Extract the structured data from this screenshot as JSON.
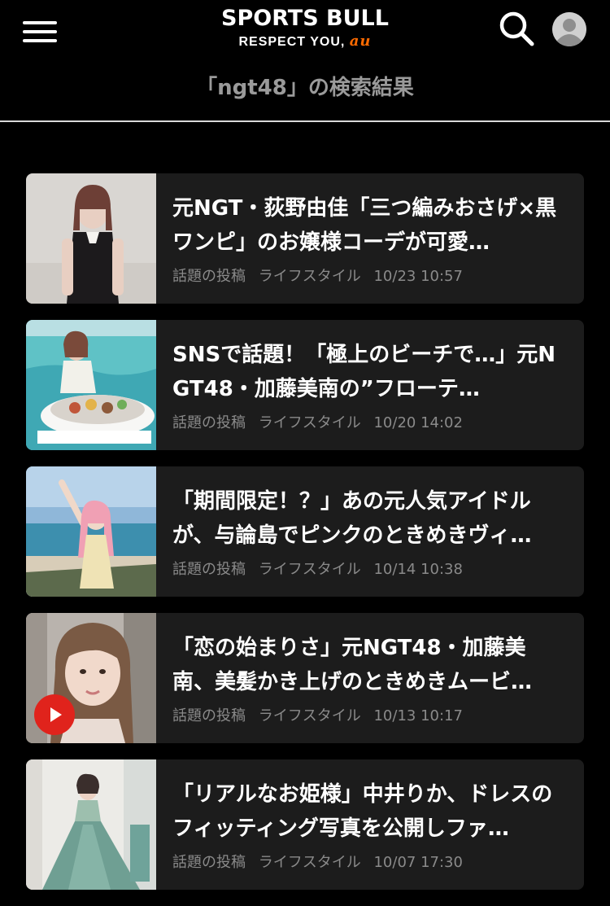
{
  "header": {
    "logo_main": "SPORTS BULL",
    "logo_sub": "RESPECT YOU,",
    "logo_au": "au",
    "search_title": "「ngt48」の検索結果"
  },
  "articles": [
    {
      "title": "元NGT・荻野由佳「三つ編みおさげ×黒ワンピ」のお嬢様コーデが可愛…",
      "source": "話題の投稿",
      "category": "ライフスタイル",
      "datetime": "10/23 10:57",
      "thumb": "girl-black-dress-photo",
      "video": false
    },
    {
      "title": "SNSで話題！「極上のビーチで…」元NGT48・加藤美南の”フローテ…",
      "source": "話題の投稿",
      "category": "ライフスタイル",
      "datetime": "10/20 14:02",
      "thumb": "woman-floating-breakfast-pool-photo",
      "video": false
    },
    {
      "title": "「期間限定！？」あの元人気アイドルが、与論島でピンクのときめきヴィ…",
      "source": "話題の投稿",
      "category": "ライフスタイル",
      "datetime": "10/14 10:38",
      "thumb": "pink-hair-woman-beach-photo",
      "video": false
    },
    {
      "title": "「恋の始まりさ」元NGT48・加藤美南、美髪かき上げのときめきムービ…",
      "source": "話題の投稿",
      "category": "ライフスタイル",
      "datetime": "10/13 10:17",
      "thumb": "woman-portrait-video-photo",
      "video": true
    },
    {
      "title": "「リアルなお姫様」中井りか、ドレスのフィッティング写真を公開しファ…",
      "source": "話題の投稿",
      "category": "ライフスタイル",
      "datetime": "10/07 17:30",
      "thumb": "woman-green-gown-photo",
      "video": false
    }
  ],
  "colors": {
    "background": "#000000",
    "card": "#1c1c1c",
    "meta_text": "#8a8a8a",
    "title_muted": "#9a9a9a",
    "play_badge": "#e0231c",
    "au_brand": "#ff6a00"
  }
}
